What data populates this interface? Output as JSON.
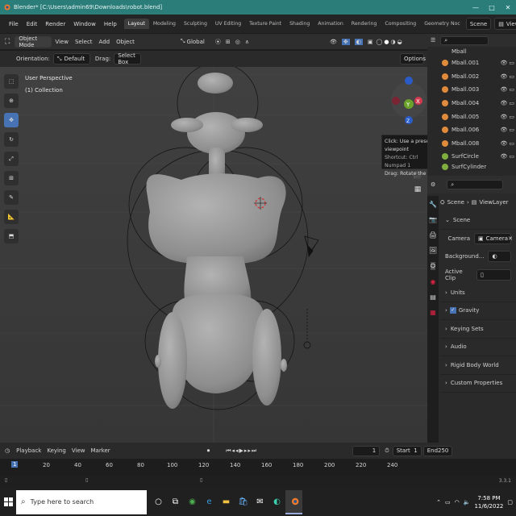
{
  "window": {
    "title": "Blender* [C:\\Users\\admin69\\Downloads\\robot.blend]",
    "controls": [
      "—",
      "□",
      "✕"
    ]
  },
  "menu": {
    "items": [
      "File",
      "Edit",
      "Render",
      "Window",
      "Help"
    ],
    "tabs": [
      "Layout",
      "Modeling",
      "Sculpting",
      "UV Editing",
      "Texture Paint",
      "Shading",
      "Animation",
      "Rendering",
      "Compositing",
      "Geometry Noc"
    ],
    "active_tab": "Layout",
    "scene_label": "Scene",
    "viewlayer_label": "ViewLayer"
  },
  "viewport_header": {
    "mode": "Object Mode",
    "menus": [
      "View",
      "Select",
      "Add",
      "Object"
    ],
    "transform": "Global"
  },
  "tool_options": {
    "orientation_label": "Orientation:",
    "orientation_value": "Default",
    "drag_label": "Drag:",
    "drag_value": "Select Box",
    "options_label": "Options"
  },
  "viewport": {
    "perspective": "User Perspective",
    "collection": "(1) Collection",
    "gizmo": {
      "x": "X",
      "y": "Y",
      "z": "Z"
    },
    "tooltip": {
      "line1": "Click: Use a preset viewpoint",
      "line2": "Shortcut: Ctrl Numpad 1",
      "line3": "Drag: Rotate the view"
    }
  },
  "outliner": {
    "items": [
      "Mball",
      "Mball.001",
      "Mball.002",
      "Mball.003",
      "Mball.004",
      "Mball.005",
      "Mball.006",
      "Mball.008",
      "SurfCircle",
      "SurfCylinder"
    ]
  },
  "properties": {
    "breadcrumb_scene": "Scene",
    "breadcrumb_viewlayer": "ViewLayer",
    "section": "Scene",
    "camera_label": "Camera",
    "camera_value": "Camera",
    "background_label": "Background...",
    "active_clip_label": "Active Clip",
    "panels": [
      "Units",
      "Gravity",
      "Keying Sets",
      "Audio",
      "Rigid Body World",
      "Custom Properties"
    ]
  },
  "timeline": {
    "menus": [
      "Playback",
      "Keying",
      "View",
      "Marker"
    ],
    "current_frame": "1",
    "start_label": "Start",
    "start": "1",
    "end_label": "End",
    "end": "250",
    "ruler": [
      "1",
      "20",
      "40",
      "60",
      "80",
      "100",
      "120",
      "140",
      "160",
      "180",
      "200",
      "220",
      "240"
    ]
  },
  "status": {
    "version": "3.3.1"
  },
  "taskbar": {
    "search_placeholder": "Type here to search",
    "time": "7:58 PM",
    "date": "11/6/2022"
  }
}
